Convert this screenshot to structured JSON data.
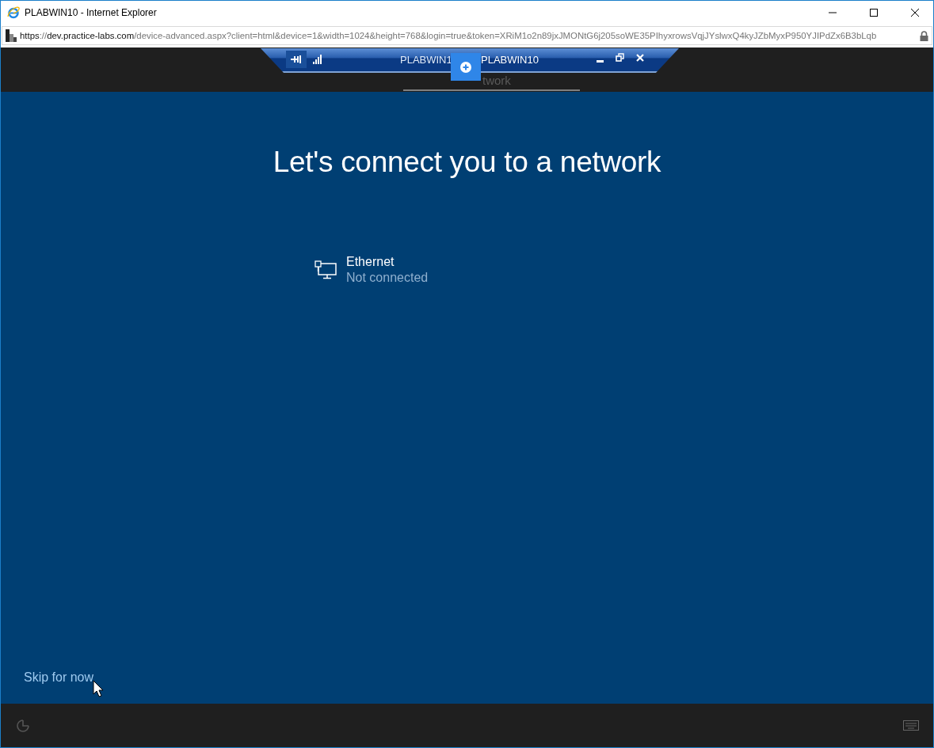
{
  "window": {
    "title": "PLABWIN10 - Internet Explorer"
  },
  "address_bar": {
    "url_parts": [
      {
        "text": "https",
        "kind": "strong"
      },
      {
        "text": "://",
        "kind": "dim"
      },
      {
        "text": "dev.practice-labs.com",
        "kind": "strong"
      },
      {
        "text": "/device-advanced.aspx?client=html&device=1&width=1024&height=768&login=true&token=XRiM1o2n89jxJMONtG6j205soWE35PIhyxrowsVqjJYslwxQ4kyJZbMyxP950YJIPdZx6B3bLqb",
        "kind": "dim"
      }
    ]
  },
  "remote_toolbar": {
    "left_title": "PLABWIN1",
    "title": "PLABWIN10"
  },
  "oobe": {
    "header_fragment": "twork",
    "heading": "Let's connect you to a network",
    "networks": [
      {
        "name": "Ethernet",
        "status": "Not connected"
      }
    ],
    "skip_link": "Skip for now"
  }
}
